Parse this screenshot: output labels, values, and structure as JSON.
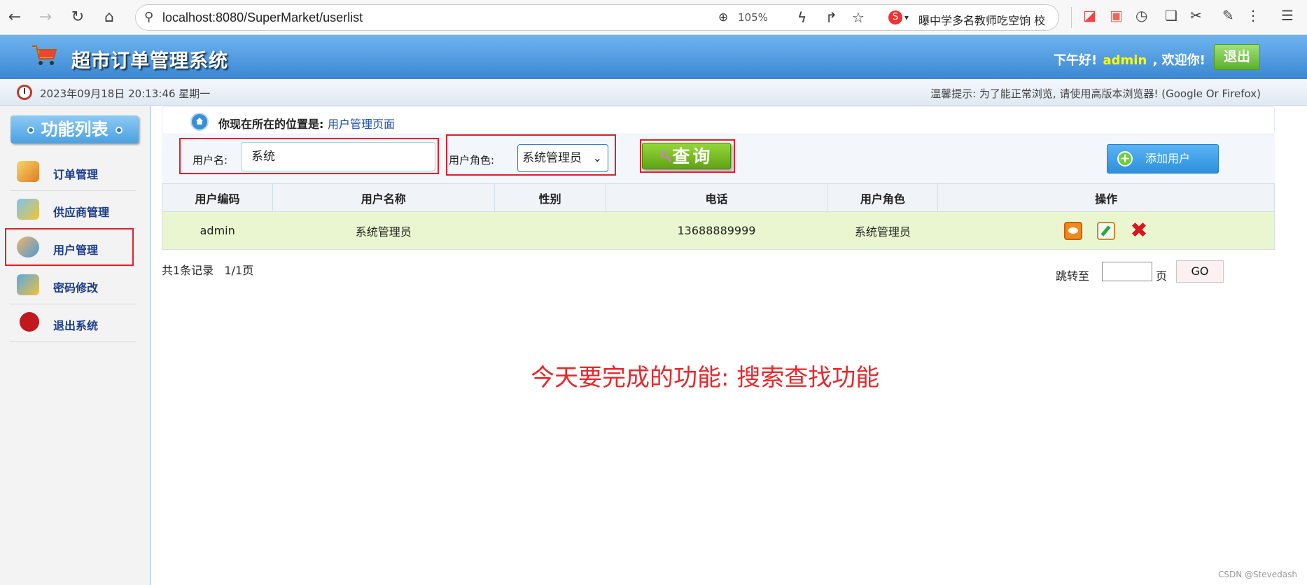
{
  "browser": {
    "url": "localhost:8080/SuperMarket/userlist",
    "zoom": "105%",
    "news_ticker": "曝中学多名教师吃空饷 校"
  },
  "header": {
    "title": "超市订单管理系统",
    "greeting_prefix": "下午好!",
    "username": "admin",
    "greeting_suffix": ", 欢迎你!",
    "logout_label": "退出"
  },
  "infobar": {
    "datetime": "2023年09月18日 20:13:46 星期一",
    "tip": "温馨提示: 为了能正常浏览, 请使用高版本浏览器! (Google Or Firefox)"
  },
  "sidebar": {
    "title": "功能列表",
    "items": [
      {
        "label": "订单管理",
        "icon": "order-icon"
      },
      {
        "label": "供应商管理",
        "icon": "supplier-icon"
      },
      {
        "label": "用户管理",
        "icon": "users-icon"
      },
      {
        "label": "密码修改",
        "icon": "password-icon"
      },
      {
        "label": "退出系统",
        "icon": "exit-icon"
      }
    ]
  },
  "breadcrumb": {
    "prefix": "你现在所在的位置是:",
    "location": "用户管理页面"
  },
  "search": {
    "username_label": "用户名:",
    "username_value": "系统",
    "role_label": "用户角色:",
    "role_value": "系统管理员",
    "query_label": "查询",
    "add_label": "添加用户"
  },
  "table": {
    "headers": [
      "用户编码",
      "用户名称",
      "性别",
      "电话",
      "用户角色",
      "操作"
    ],
    "rows": [
      {
        "code": "admin",
        "name": "系统管理员",
        "gender": "",
        "phone": "13688889999",
        "role": "系统管理员"
      }
    ]
  },
  "pager": {
    "summary": "共1条记录   1/1页",
    "jump_label": "跳转至",
    "page_label": "页",
    "go_label": "GO"
  },
  "annotation": "今天要完成的功能: 搜索查找功能",
  "watermark": "CSDN @Stevedash",
  "colors": {
    "header_blue": "#3b87d4",
    "annotation_red": "#e8282c",
    "highlight_red": "#e0202a",
    "row_green": "#e9f6cf",
    "query_green": "#5fa314"
  }
}
